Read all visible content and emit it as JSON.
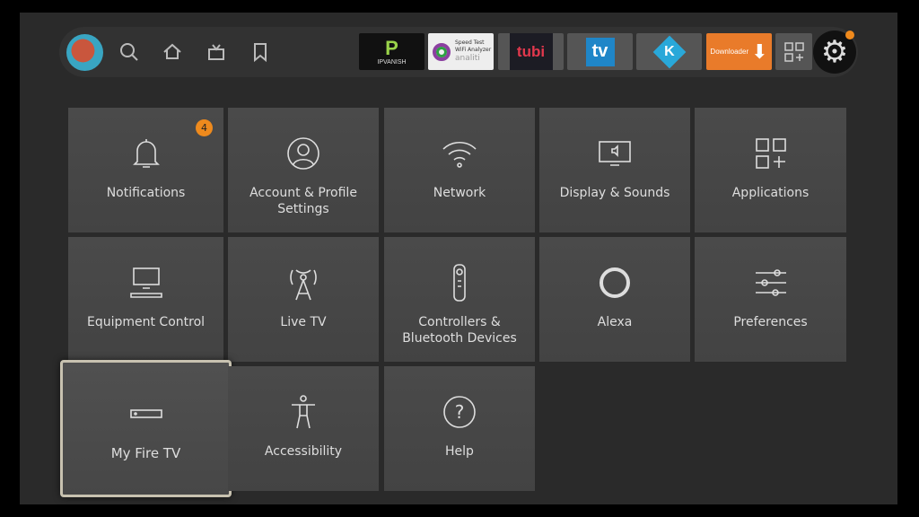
{
  "nav": {
    "icons": [
      "search-icon",
      "home-icon",
      "live-tv-icon",
      "bookmark-icon"
    ]
  },
  "apps": [
    {
      "name": "IPVanish",
      "label": "IPVANISH"
    },
    {
      "name": "Speed Test WiFi Analyzer",
      "label1": "Speed Test",
      "label2": "WiFi Analyzer",
      "label3": "analiti"
    },
    {
      "name": "tubi",
      "label": "tubi"
    },
    {
      "name": "tv",
      "label": "tv"
    },
    {
      "name": "Kodi",
      "label": "K"
    },
    {
      "name": "Downloader",
      "label": "Downloader"
    }
  ],
  "colors": {
    "accent": "#ee8a1d",
    "tile": "#4a4a4a",
    "background": "#2a2a2a"
  },
  "tiles": [
    {
      "label": "Notifications",
      "icon": "bell-icon",
      "badge": "4"
    },
    {
      "label": "Account & Profile Settings",
      "icon": "profile-icon"
    },
    {
      "label": "Network",
      "icon": "wifi-icon"
    },
    {
      "label": "Display & Sounds",
      "icon": "display-icon"
    },
    {
      "label": "Applications",
      "icon": "apps-icon"
    },
    {
      "label": "Equipment Control",
      "icon": "equipment-icon"
    },
    {
      "label": "Live TV",
      "icon": "antenna-icon"
    },
    {
      "label": "Controllers & Bluetooth Devices",
      "icon": "remote-icon"
    },
    {
      "label": "Alexa",
      "icon": "alexa-icon"
    },
    {
      "label": "Preferences",
      "icon": "sliders-icon"
    },
    {
      "label": "My Fire TV",
      "icon": "fire-tv-icon"
    },
    {
      "label": "Accessibility",
      "icon": "accessibility-icon"
    },
    {
      "label": "Help",
      "icon": "help-icon"
    }
  ]
}
